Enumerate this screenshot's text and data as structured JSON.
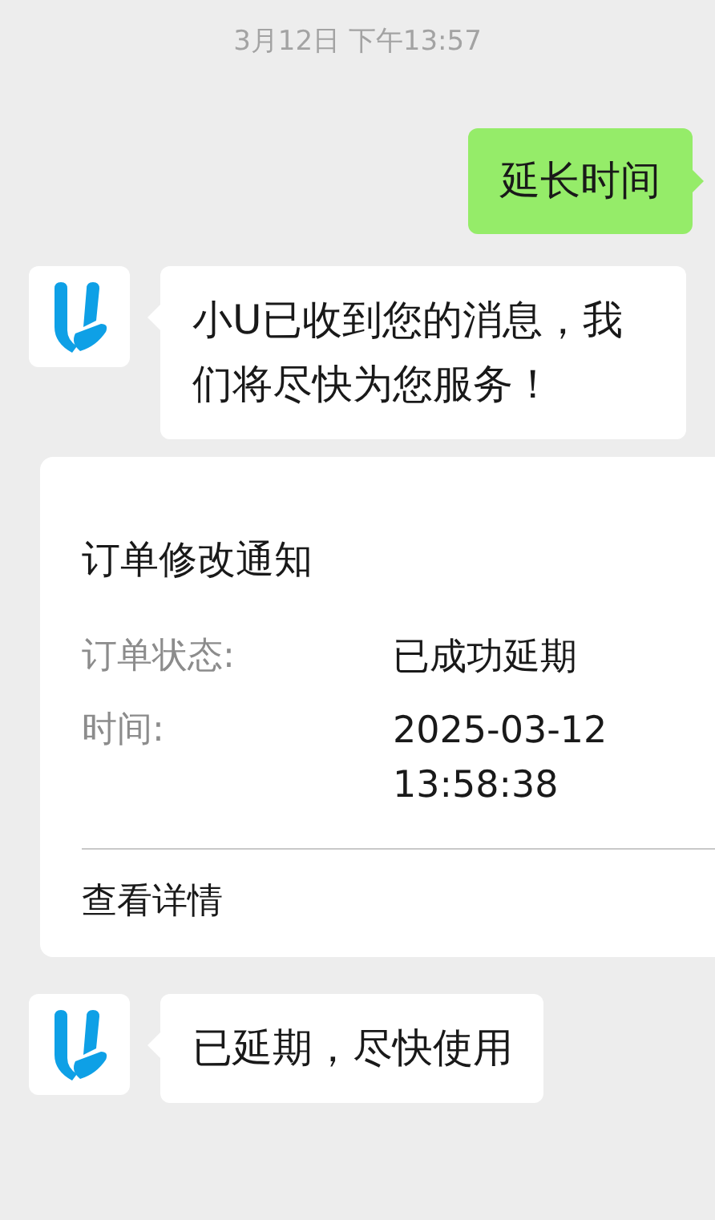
{
  "timestamp": "3月12日 下午13:57",
  "messages": [
    {
      "kind": "sent",
      "lines": [
        "延长时间"
      ]
    },
    {
      "kind": "received",
      "lines": [
        "小U已收到您的消息，我",
        "们将尽快为您服务！"
      ]
    },
    {
      "kind": "card",
      "title": "订单修改通知",
      "fields": [
        {
          "label": "订单状态:",
          "value": "已成功延期"
        },
        {
          "label": "时间:",
          "value": "2025-03-12 13:58:38"
        }
      ],
      "link": "查看详情"
    },
    {
      "kind": "received",
      "lines": [
        "已延期，尽快使用"
      ]
    }
  ]
}
